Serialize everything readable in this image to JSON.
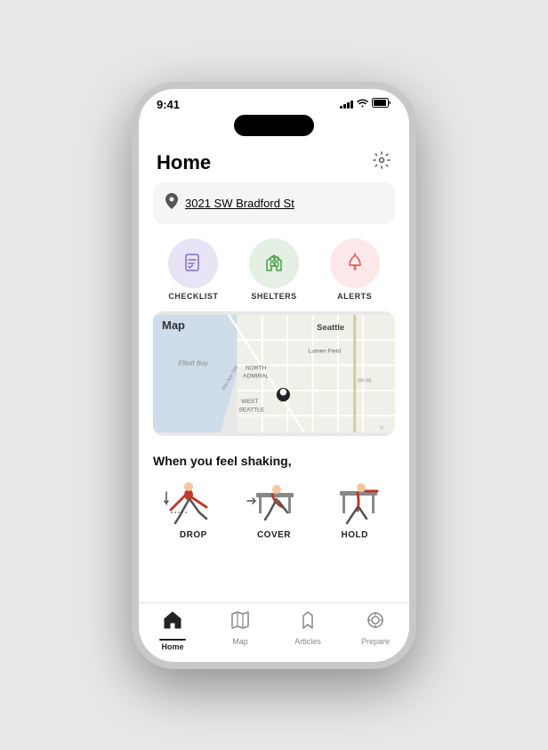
{
  "status": {
    "time": "9:41",
    "signal": [
      3,
      5,
      7,
      9,
      11
    ],
    "wifi": true,
    "battery": true
  },
  "header": {
    "title": "Home",
    "settings_label": "settings"
  },
  "address": {
    "text": "3021 SW Bradford St"
  },
  "actions": [
    {
      "id": "checklist",
      "label": "CHECKLIST",
      "color_class": "icon-checklist"
    },
    {
      "id": "shelters",
      "label": "SHELTERS",
      "color_class": "icon-shelters"
    },
    {
      "id": "alerts",
      "label": "ALERTS",
      "color_class": "icon-alerts"
    }
  ],
  "map": {
    "label": "Map",
    "area_labels": [
      "Elliott Bay",
      "Seattle",
      "Lumen Field",
      "NORTH ADMIRAL",
      "WEST SEATTLE"
    ],
    "road_labels": [
      "Alki Ave SW",
      "SR 99"
    ]
  },
  "dch": {
    "title": "When you feel shaking,",
    "items": [
      {
        "id": "drop",
        "label": "DROP"
      },
      {
        "id": "cover",
        "label": "COVER"
      },
      {
        "id": "hold",
        "label": "HOLD"
      }
    ]
  },
  "nav": {
    "items": [
      {
        "id": "home",
        "label": "Home",
        "active": true
      },
      {
        "id": "map",
        "label": "Map",
        "active": false
      },
      {
        "id": "articles",
        "label": "Articles",
        "active": false
      },
      {
        "id": "prepare",
        "label": "Prepare",
        "active": false
      }
    ]
  }
}
